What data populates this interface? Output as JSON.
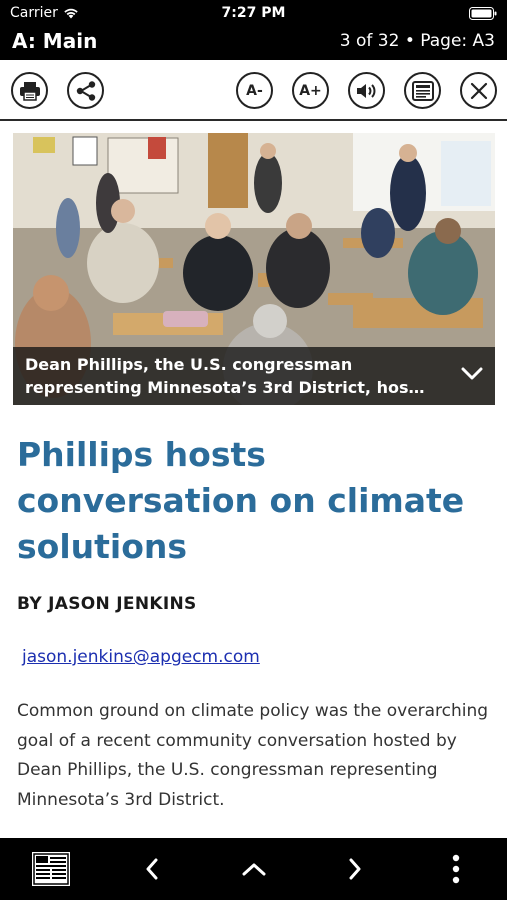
{
  "status_bar": {
    "carrier": "Carrier",
    "time": "7:27 PM"
  },
  "header": {
    "section": "A: Main",
    "position": "3 of 32 • Page: A3"
  },
  "toolbar": {
    "font_decrease_label": "A-",
    "font_increase_label": "A+",
    "icons": [
      "print-icon",
      "share-icon",
      "speaker-icon",
      "text-view-icon",
      "close-icon"
    ]
  },
  "photo": {
    "caption": "Dean Phillips, the U.S. congressman representing Minnesota’s 3rd District, hos…"
  },
  "article": {
    "headline": "Phillips hosts conversation on climate solutions",
    "byline": "BY JASON JENKINS",
    "email": "jason.jenkins@apgecm.com",
    "body": "Common ground on climate policy was the overarching goal of a recent community conversation hosted by Dean Phillips, the U.S. congressman representing Minnesota’s 3rd District."
  },
  "bottom_nav": {
    "icons": [
      "newspaper-icon",
      "chevron-left-icon",
      "chevron-up-icon",
      "chevron-right-icon",
      "more-vertical-icon"
    ]
  },
  "colors": {
    "headline": "#2b6c9a",
    "link": "#1c2fb0",
    "bars": "#000000"
  }
}
